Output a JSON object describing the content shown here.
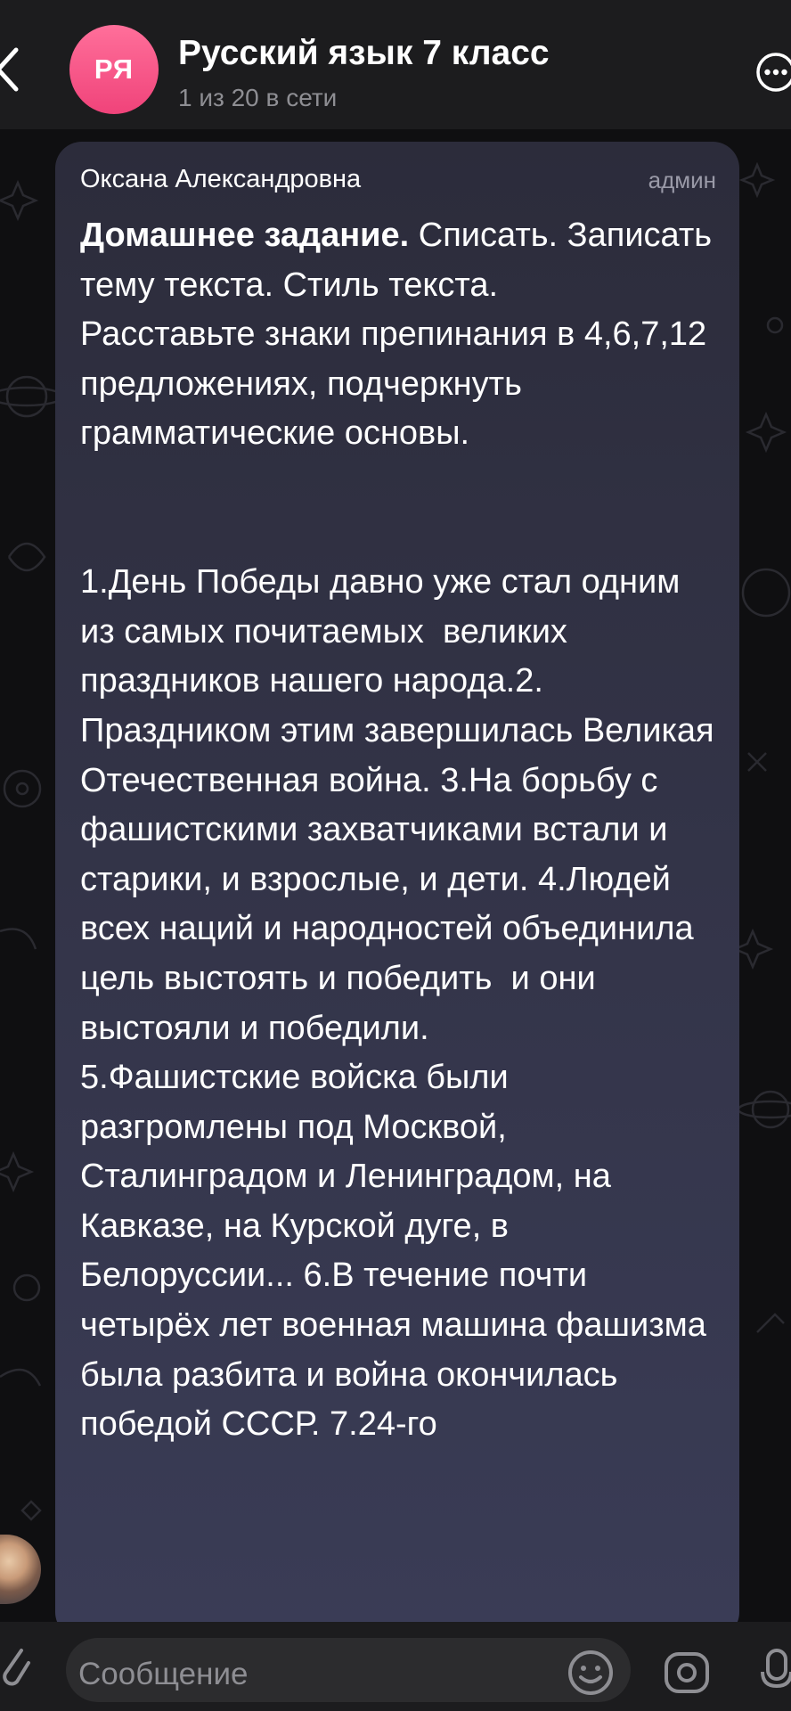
{
  "header": {
    "avatar_initials": "РЯ",
    "title": "Русский язык 7 класс",
    "subtitle": "1 из 20 в сети"
  },
  "message": {
    "sender": "Оксана Александровна",
    "role": "админ",
    "heading": "Домашнее задание.",
    "body": " Списать. Записать тему текста. Стиль текста.\nРасставьте знаки препинания в 4,6,7,12 предложениях, подчеркнуть грамматические основы.\n\n\n1.День Победы давно уже стал одним из самых почитаемых  великих праздников нашего народа.2. Праздником этим завершилась Великая Отечественная война. 3.На борьбу с фашистскими захватчиками встали и старики, и взрослые, и дети. 4.Людей всех наций и народностей объединила цель выстоять и победить  и они выстояли и победили.\n5.Фашистские войска были разгромлены под Москвой, Сталинградом и Ленинградом, на Кавказе, на Курской дуге, в Белоруссии... 6.В течение почти четырёх лет военная машина фашизма была разбита и война окончилась победой СССР. 7.24-го"
  },
  "input": {
    "placeholder": "Сообщение"
  },
  "icons": {
    "back": "chevron-left-icon",
    "more": "more-horizontal-icon",
    "scroll_down": "chevron-down-icon",
    "attach": "paperclip-icon",
    "emoji": "emoji-icon",
    "camera": "camera-icon",
    "mic": "microphone-icon"
  },
  "colors": {
    "avatar_gradient": "#f0437a",
    "bubble": "#34354a",
    "secondary_text": "#8e8e93"
  }
}
